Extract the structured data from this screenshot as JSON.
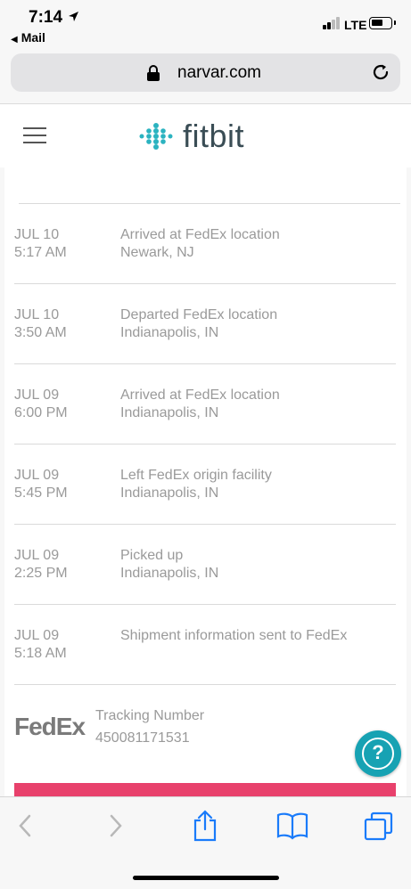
{
  "status_bar": {
    "time": "7:14",
    "back_app": "Mail",
    "network": "LTE"
  },
  "browser": {
    "url": "narvar.com",
    "icons": [
      "lock-icon",
      "reload-icon",
      "back-arrow-icon",
      "forward-arrow-icon",
      "share-icon",
      "bookmarks-icon",
      "tabs-icon"
    ]
  },
  "site": {
    "brand": "fitbit",
    "brand_color": "#3a4d55",
    "logo_dot_color": "#2bb3c0"
  },
  "tracking_events": [
    {
      "date": "JUL 10",
      "time": "5:17 AM",
      "status": "Arrived at FedEx location",
      "location": "Newark, NJ"
    },
    {
      "date": "JUL 10",
      "time": "3:50 AM",
      "status": "Departed FedEx location",
      "location": "Indianapolis, IN"
    },
    {
      "date": "JUL 09",
      "time": "6:00 PM",
      "status": "Arrived at FedEx location",
      "location": "Indianapolis, IN"
    },
    {
      "date": "JUL 09",
      "time": "5:45 PM",
      "status": "Left FedEx origin facility",
      "location": "Indianapolis, IN"
    },
    {
      "date": "JUL 09",
      "time": "2:25 PM",
      "status": "Picked up",
      "location": "Indianapolis, IN"
    },
    {
      "date": "JUL 09",
      "time": "5:18 AM",
      "status": "Shipment information sent to FedEx",
      "location": ""
    }
  ],
  "carrier": {
    "name": "FedEx",
    "tracking_label": "Tracking Number",
    "tracking_number": "450081171531"
  },
  "help": {
    "label": "?",
    "color": "#17a2b3"
  },
  "accent_color": "#e8416c"
}
